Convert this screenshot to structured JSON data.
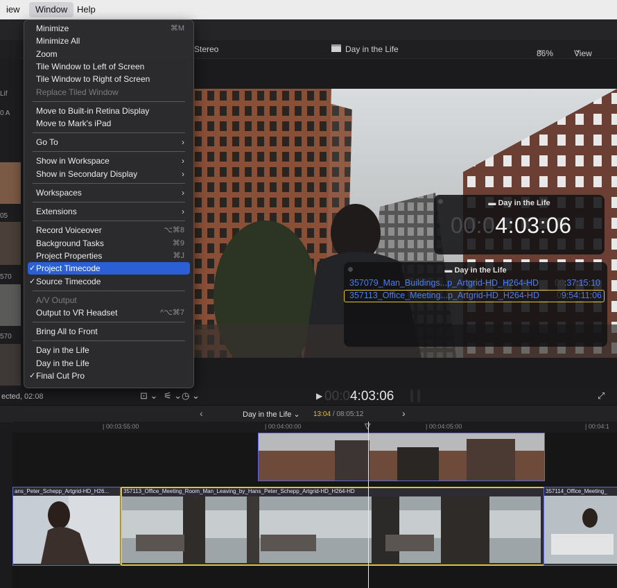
{
  "menubar": {
    "items": [
      "iew",
      "Window",
      "Help"
    ]
  },
  "viewer_header": {
    "audio": "Stereo",
    "title": "Day in the Life",
    "zoom": "86%",
    "view": "View"
  },
  "left_strip": {
    "texts": [
      "Lif",
      "0 A",
      "05",
      "570",
      "570"
    ]
  },
  "window_menu": {
    "groups": [
      [
        {
          "label": "Minimize",
          "shortcut": "⌘M"
        },
        {
          "label": "Minimize All"
        },
        {
          "label": "Zoom"
        },
        {
          "label": "Tile Window to Left of Screen"
        },
        {
          "label": "Tile Window to Right of Screen"
        },
        {
          "label": "Replace Tiled Window",
          "disabled": true
        }
      ],
      [
        {
          "label": "Move to Built-in Retina Display"
        },
        {
          "label": "Move to Mark's iPad"
        }
      ],
      [
        {
          "label": "Go To",
          "submenu": true
        }
      ],
      [
        {
          "label": "Show in Workspace",
          "submenu": true
        },
        {
          "label": "Show in Secondary Display",
          "submenu": true
        }
      ],
      [
        {
          "label": "Workspaces",
          "submenu": true
        }
      ],
      [
        {
          "label": "Extensions",
          "submenu": true
        }
      ],
      [
        {
          "label": "Record Voiceover",
          "shortcut": "⌥⌘8"
        },
        {
          "label": "Background Tasks",
          "shortcut": "⌘9"
        },
        {
          "label": "Project Properties",
          "shortcut": "⌘J"
        },
        {
          "label": "Project Timecode",
          "checked": true,
          "highlighted": true
        },
        {
          "label": "Source Timecode",
          "checked": true
        }
      ],
      [
        {
          "label": "A/V Output",
          "disabled": true
        },
        {
          "label": "Output to VR Headset",
          "shortcut": "^⌥⌘7"
        }
      ],
      [
        {
          "label": "Bring All to Front"
        }
      ],
      [
        {
          "label": "Day in the Life"
        },
        {
          "label": "Day in the Life"
        },
        {
          "label": "Final Cut Pro",
          "checked": true
        }
      ]
    ]
  },
  "timecode_hud": {
    "title": "Day in the Life",
    "dim": "00:0",
    "bright": "4:03:06"
  },
  "source_hud": {
    "title": "Day in the Life",
    "rows": [
      {
        "name": "357079_Man_Buildings...p_Artgrid-HD_H264-HD",
        "tc_dim": "00",
        "tc": ":37:15:10"
      },
      {
        "name": "357113_Office_Meeting...p_Artgrid-HD_H264-HD",
        "tc_dim": "0",
        "tc": "9:54:11:06"
      }
    ]
  },
  "transport": {
    "selected": "ected, 02:08",
    "tc_dim": "00:0",
    "tc": "4:03:06"
  },
  "timeline_header": {
    "prev": "‹",
    "project": "Day in the Life",
    "position": "13:04",
    "duration": "/ 08:05:12",
    "next": "›"
  },
  "ruler": {
    "ticks": [
      "00:03:55:00",
      "00:04:00:00",
      "00:04:05:00",
      "00:04:1"
    ]
  },
  "clips": {
    "left": "ans_Peter_Schepp_Artgrid-HD_H26...",
    "main": "357113_Office_Meeting_Room_Man_Leaving_by_Hans_Peter_Schepp_Artgrid-HD_H264-HD",
    "right": "357114_Office_Meeting_"
  },
  "colors": {
    "accent": "#2c5fd6",
    "selection": "#e5c235",
    "clip_blue": "#5e6ad2"
  }
}
